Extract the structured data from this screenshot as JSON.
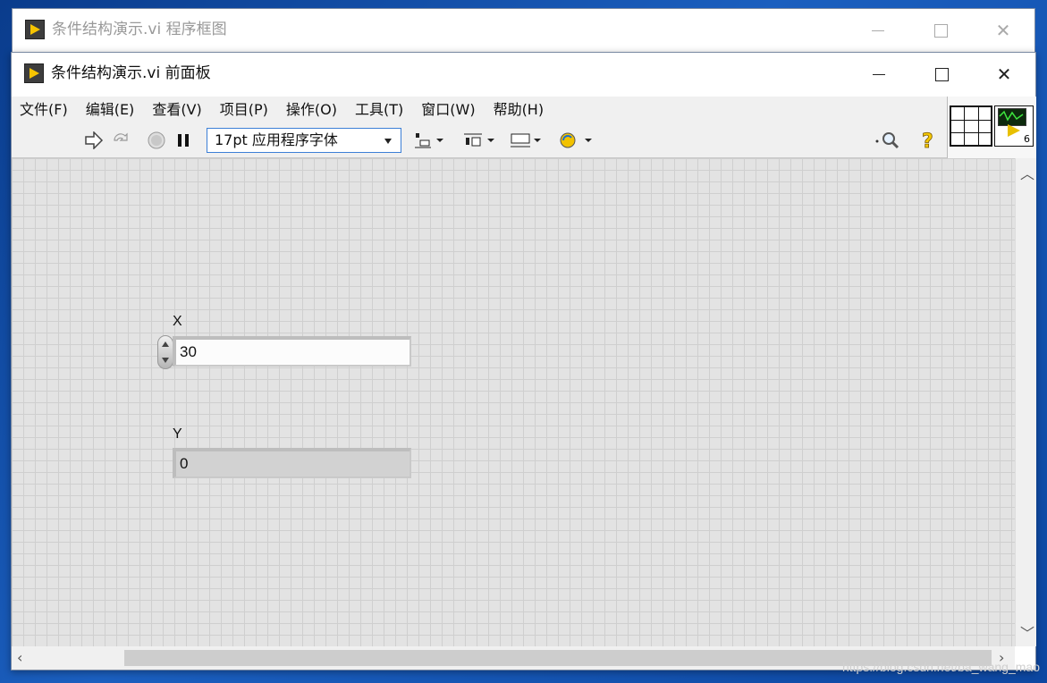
{
  "back_window": {
    "title": "条件结构演示.vi 程序框图"
  },
  "front_window": {
    "title": "条件结构演示.vi 前面板"
  },
  "menu": [
    "文件(F)",
    "编辑(E)",
    "查看(V)",
    "项目(P)",
    "操作(O)",
    "工具(T)",
    "窗口(W)",
    "帮助(H)"
  ],
  "toolbar": {
    "font_select": "17pt 应用程序字体",
    "buttons": [
      "run-arrow-icon",
      "run-continuous-icon",
      "abort-icon",
      "pause-icon",
      "align-icon",
      "distribute-icon",
      "resize-icon",
      "reorder-icon",
      "search-icon",
      "help-icon"
    ]
  },
  "vi_icon": {
    "number": "6"
  },
  "controls": {
    "x": {
      "label": "X",
      "value": "30"
    },
    "y": {
      "label": "Y",
      "value": "0"
    }
  },
  "colors": {
    "accent": "#f7c400",
    "desktop": "#1b5fbf",
    "focus_border": "#3c7fd6"
  },
  "watermark": "https://blog.csdn.net/ba_wang_mao"
}
